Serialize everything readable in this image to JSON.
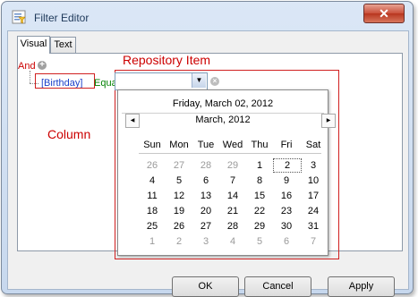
{
  "window": {
    "title": "Filter Editor",
    "close_glyph": "✕"
  },
  "tabs": [
    {
      "label": "Visual"
    },
    {
      "label": "Text"
    }
  ],
  "filter": {
    "group_operator": "And",
    "add_glyph": "+",
    "field": "[Birthday]",
    "operator": "Equals",
    "clear_glyph": "×"
  },
  "annotations": {
    "repository_item": "Repository Item",
    "column": "Column"
  },
  "buttons": {
    "ok": "OK",
    "cancel": "Cancel",
    "apply": "Apply"
  },
  "calendar": {
    "today": "Friday, March 02, 2012",
    "month": "March, 2012",
    "prev_glyph": "◀",
    "next_glyph": "▶",
    "dropdown_glyph": "▼",
    "weekdays": [
      "Sun",
      "Mon",
      "Tue",
      "Wed",
      "Thu",
      "Fri",
      "Sat"
    ],
    "weeks": [
      [
        "26",
        "27",
        "28",
        "29",
        "1",
        "2",
        "3"
      ],
      [
        "4",
        "5",
        "6",
        "7",
        "8",
        "9",
        "10"
      ],
      [
        "11",
        "12",
        "13",
        "14",
        "15",
        "16",
        "17"
      ],
      [
        "18",
        "19",
        "20",
        "21",
        "22",
        "23",
        "24"
      ],
      [
        "25",
        "26",
        "27",
        "28",
        "29",
        "30",
        "31"
      ],
      [
        "1",
        "2",
        "3",
        "4",
        "5",
        "6",
        "7"
      ]
    ],
    "selected": "2"
  },
  "colors": {
    "annotation": "#cc0000",
    "field": "#1a3ec9",
    "operator": "#008000"
  }
}
